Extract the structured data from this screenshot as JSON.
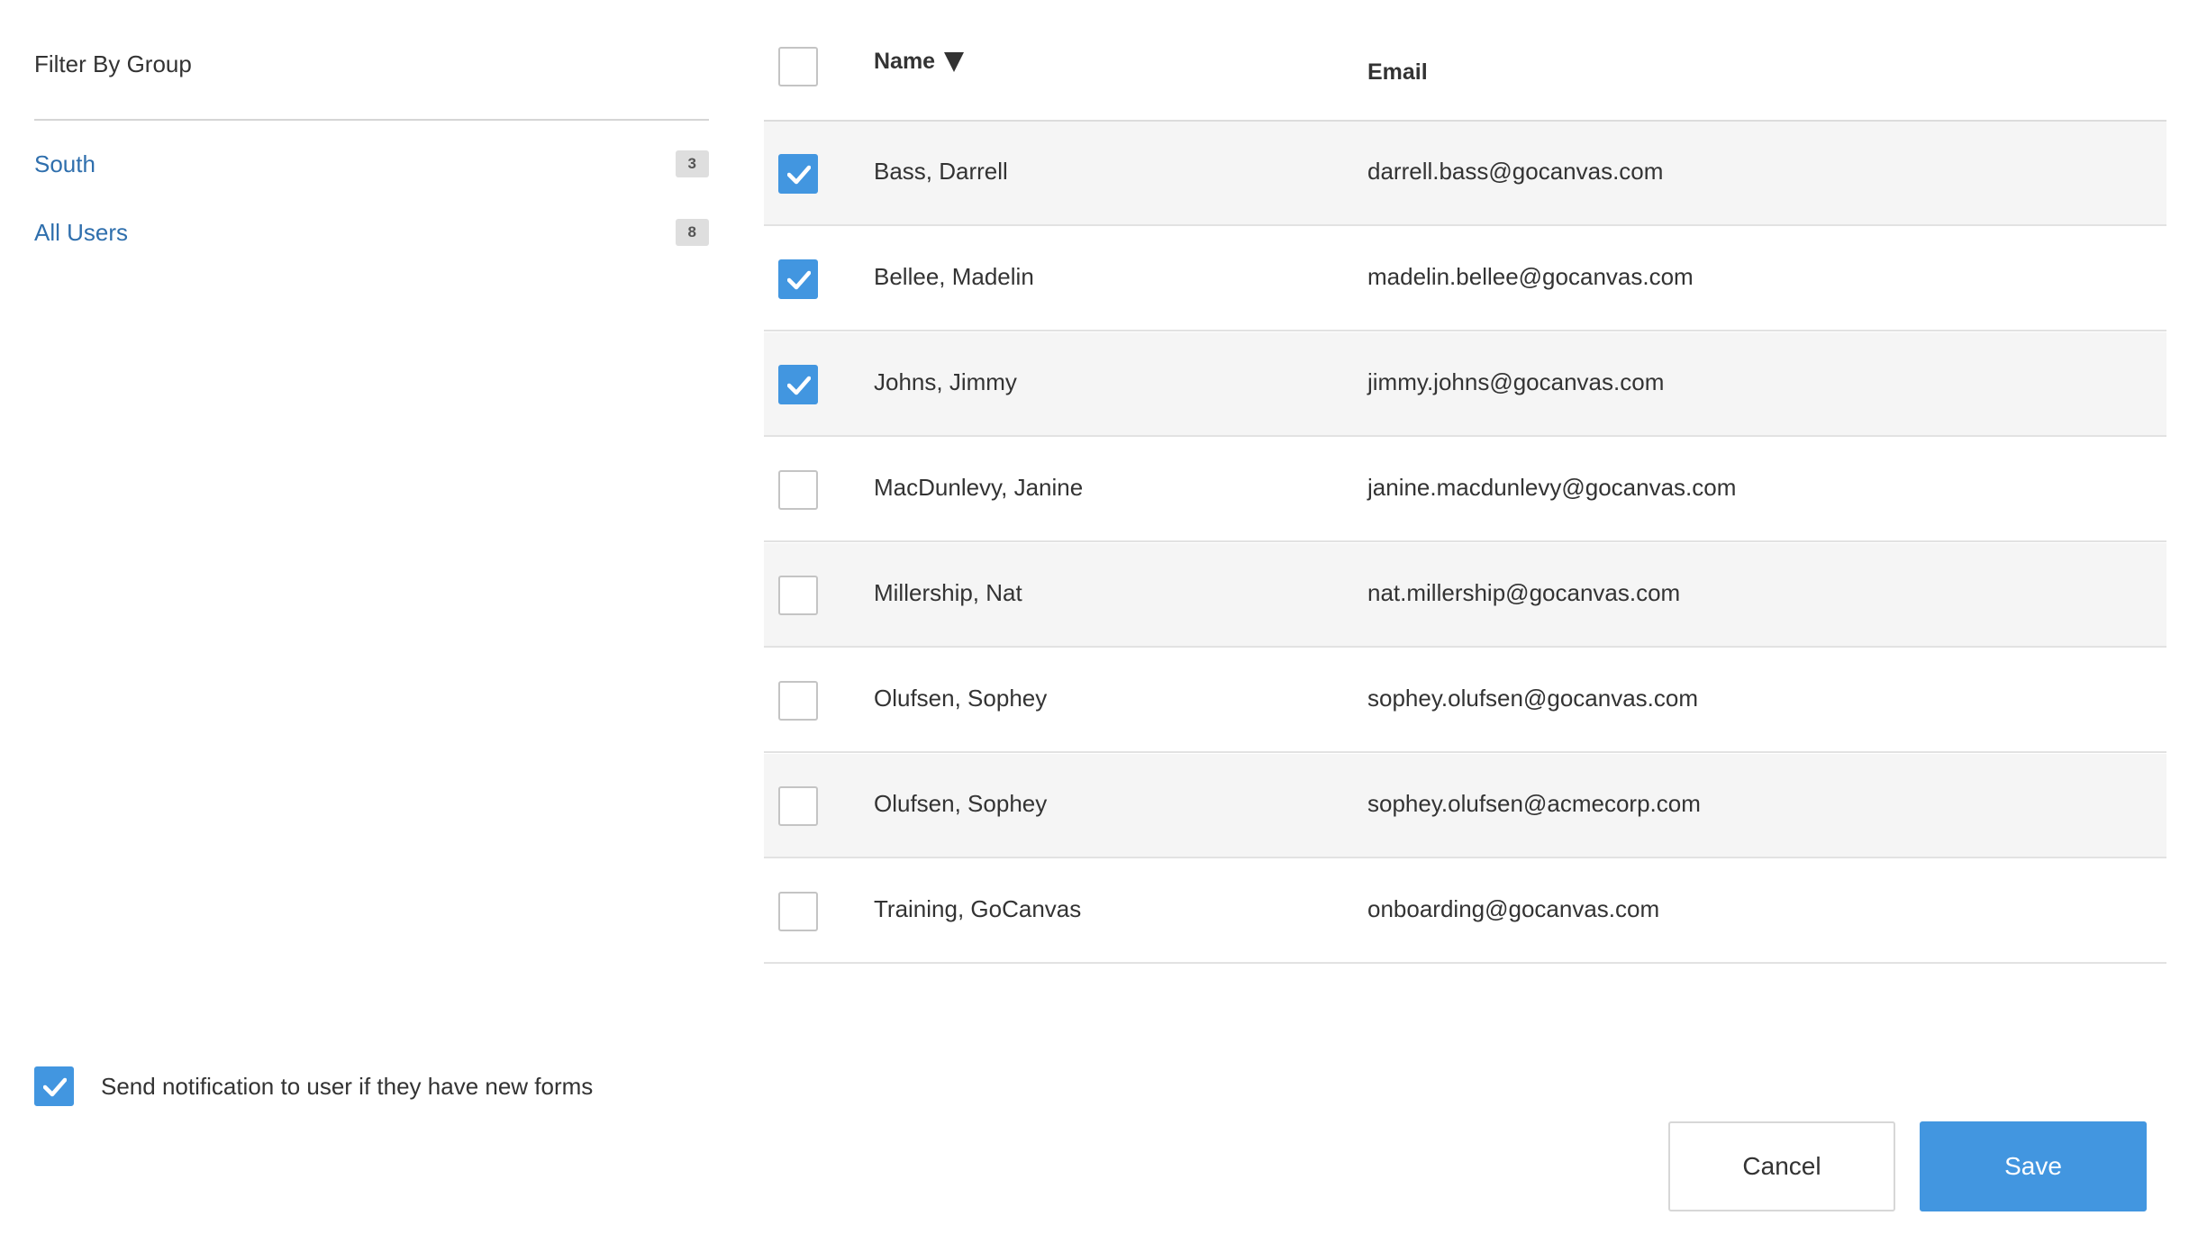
{
  "sidebar": {
    "title": "Filter By Group",
    "groups": [
      {
        "label": "South",
        "count": "3"
      },
      {
        "label": "All Users",
        "count": "8"
      }
    ]
  },
  "table": {
    "columns": {
      "name": "Name",
      "email": "Email"
    },
    "select_all_checked": false,
    "sort": {
      "column": "Name",
      "direction": "descending-arrow"
    },
    "rows": [
      {
        "name": "Bass, Darrell",
        "email": "darrell.bass@gocanvas.com",
        "checked": true
      },
      {
        "name": "Bellee, Madelin",
        "email": "madelin.bellee@gocanvas.com",
        "checked": true
      },
      {
        "name": "Johns, Jimmy",
        "email": "jimmy.johns@gocanvas.com",
        "checked": true
      },
      {
        "name": "MacDunlevy, Janine",
        "email": "janine.macdunlevy@gocanvas.com",
        "checked": false
      },
      {
        "name": "Millership, Nat",
        "email": "nat.millership@gocanvas.com",
        "checked": false
      },
      {
        "name": "Olufsen, Sophey",
        "email": "sophey.olufsen@gocanvas.com",
        "checked": false
      },
      {
        "name": "Olufsen, Sophey",
        "email": "sophey.olufsen@acmecorp.com",
        "checked": false
      },
      {
        "name": "Training, GoCanvas",
        "email": "onboarding@gocanvas.com",
        "checked": false
      }
    ]
  },
  "notification": {
    "label": "Send notification to user if they have new forms",
    "checked": true
  },
  "actions": {
    "cancel_label": "Cancel",
    "save_label": "Save"
  },
  "colors": {
    "accent": "#4296e0",
    "link": "#2f6fad",
    "row_alt": "#f5f5f5",
    "badge": "#dedede"
  },
  "icons": {
    "check": "check-icon",
    "sort": "sort-desc-icon"
  }
}
